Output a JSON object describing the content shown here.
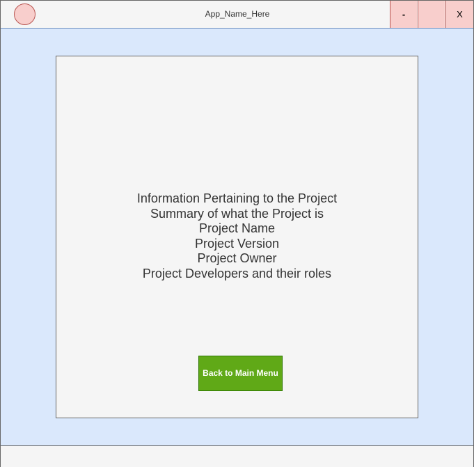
{
  "window": {
    "title": "App_Name_Here",
    "minimize_label": "-",
    "maximize_label": "",
    "close_label": "X"
  },
  "content": {
    "lines": [
      "Information Pertaining to the Project",
      "Summary of what the Project is",
      "Project Name",
      "Project Version",
      "Project Owner",
      "Project Developers and their roles"
    ],
    "back_button_label": "Back to Main Menu"
  },
  "colors": {
    "window_background": "#dae8fc",
    "titlebar_background": "#f5f5f5",
    "window_button_background": "#f8cecc",
    "window_button_border": "#b85450",
    "panel_background": "#f5f5f5",
    "back_button_background": "#60a917"
  },
  "icons": {
    "app_icon": "circle-app-icon"
  }
}
